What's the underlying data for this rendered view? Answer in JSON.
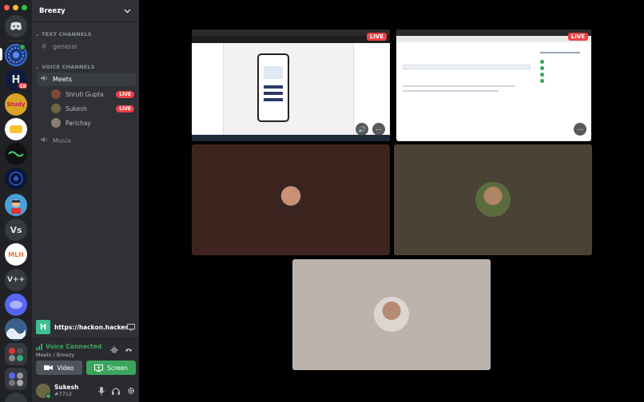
{
  "server": {
    "name": "Breezy",
    "servers": [
      {
        "id": "dm",
        "label": ""
      },
      {
        "id": "s1",
        "label": ""
      },
      {
        "id": "s2",
        "label": "H",
        "badge": "18"
      },
      {
        "id": "s3",
        "label": "Study"
      },
      {
        "id": "s4",
        "label": ""
      },
      {
        "id": "s5",
        "label": ""
      },
      {
        "id": "s6",
        "label": ""
      },
      {
        "id": "s7",
        "label": ""
      },
      {
        "id": "s8",
        "label": "Vs"
      },
      {
        "id": "s9",
        "label": "MLH"
      },
      {
        "id": "s10",
        "label": "V++"
      },
      {
        "id": "s11",
        "label": ""
      },
      {
        "id": "s12",
        "label": ""
      },
      {
        "id": "s13",
        "label": ""
      },
      {
        "id": "s14",
        "label": ""
      }
    ]
  },
  "channels": {
    "text_category": "TEXT CHANNELS",
    "text_channels": [
      "general"
    ],
    "voice_category": "VOICE CHANNELS",
    "voice_channels": [
      {
        "name": "Meets",
        "active": true
      },
      {
        "name": "Musix",
        "active": false
      }
    ],
    "members": [
      {
        "name": "Shruti Gupta",
        "live": "LIVE",
        "color": "#7b4a3a"
      },
      {
        "name": "Sukesh",
        "live": "LIVE",
        "color": "#6b6a45"
      },
      {
        "name": "Parichay",
        "live": "",
        "color": "#8a7d72"
      }
    ]
  },
  "stream": {
    "icon_letter": "H",
    "title": "https://hackon.hacker..."
  },
  "voice": {
    "status": "Voice Connected",
    "location": "Meets / Breezy",
    "video_label": "Video",
    "screen_label": "Screen"
  },
  "user": {
    "name": "Sukesh",
    "tag": "#7712"
  },
  "tiles": {
    "live_label": "LIVE",
    "colors": {
      "shruti_bg": "#3f231f",
      "sukesh_bg": "#4a4234",
      "parichay_bg": "#bdb3ad",
      "accent_green": "#3ba55d",
      "live_red": "#ed4245",
      "blurple": "#5865f2"
    }
  }
}
